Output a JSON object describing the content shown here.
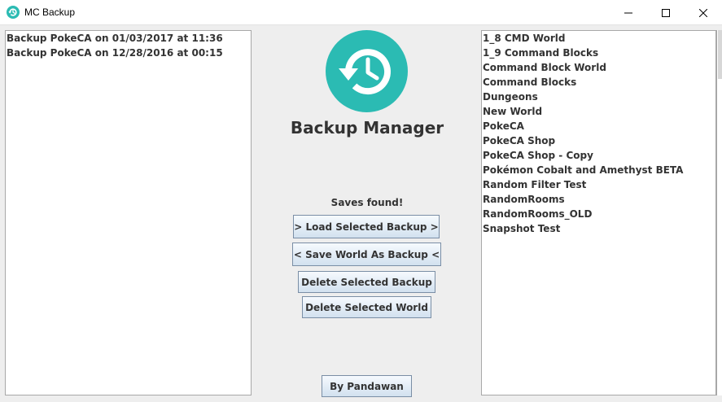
{
  "window": {
    "title": "MC Backup",
    "controls": {
      "minimize": "minimize-icon",
      "maximize": "maximize-icon",
      "close": "close-icon"
    }
  },
  "backups": [
    "Backup PokeCA on 01/03/2017 at 11:36",
    "Backup PokeCA on 12/28/2016 at 00:15"
  ],
  "center": {
    "logo_icon": "backup-restore-clock-icon",
    "heading": "Backup Manager",
    "status": "Saves found!",
    "buttons": {
      "load": "> Load Selected Backup >",
      "save": "< Save World As Backup <",
      "delete_backup": "Delete Selected Backup",
      "delete_world": "Delete Selected World",
      "author": "By Pandawan"
    }
  },
  "worlds": [
    "1_8 CMD World",
    "1_9 Command Blocks",
    "Command Block World",
    "Command Blocks",
    "Dungeons",
    "New World",
    "PokeCA",
    "PokeCA Shop",
    "PokeCA Shop - Copy",
    "Pokémon Cobalt and Amethyst BETA",
    "Random Filter Test",
    "RandomRooms",
    "RandomRooms_OLD",
    "Snapshot Test"
  ],
  "colors": {
    "accent": "#2bbbb3",
    "window_bg": "#eeeeee",
    "list_bg": "#ffffff",
    "text": "#333333"
  }
}
